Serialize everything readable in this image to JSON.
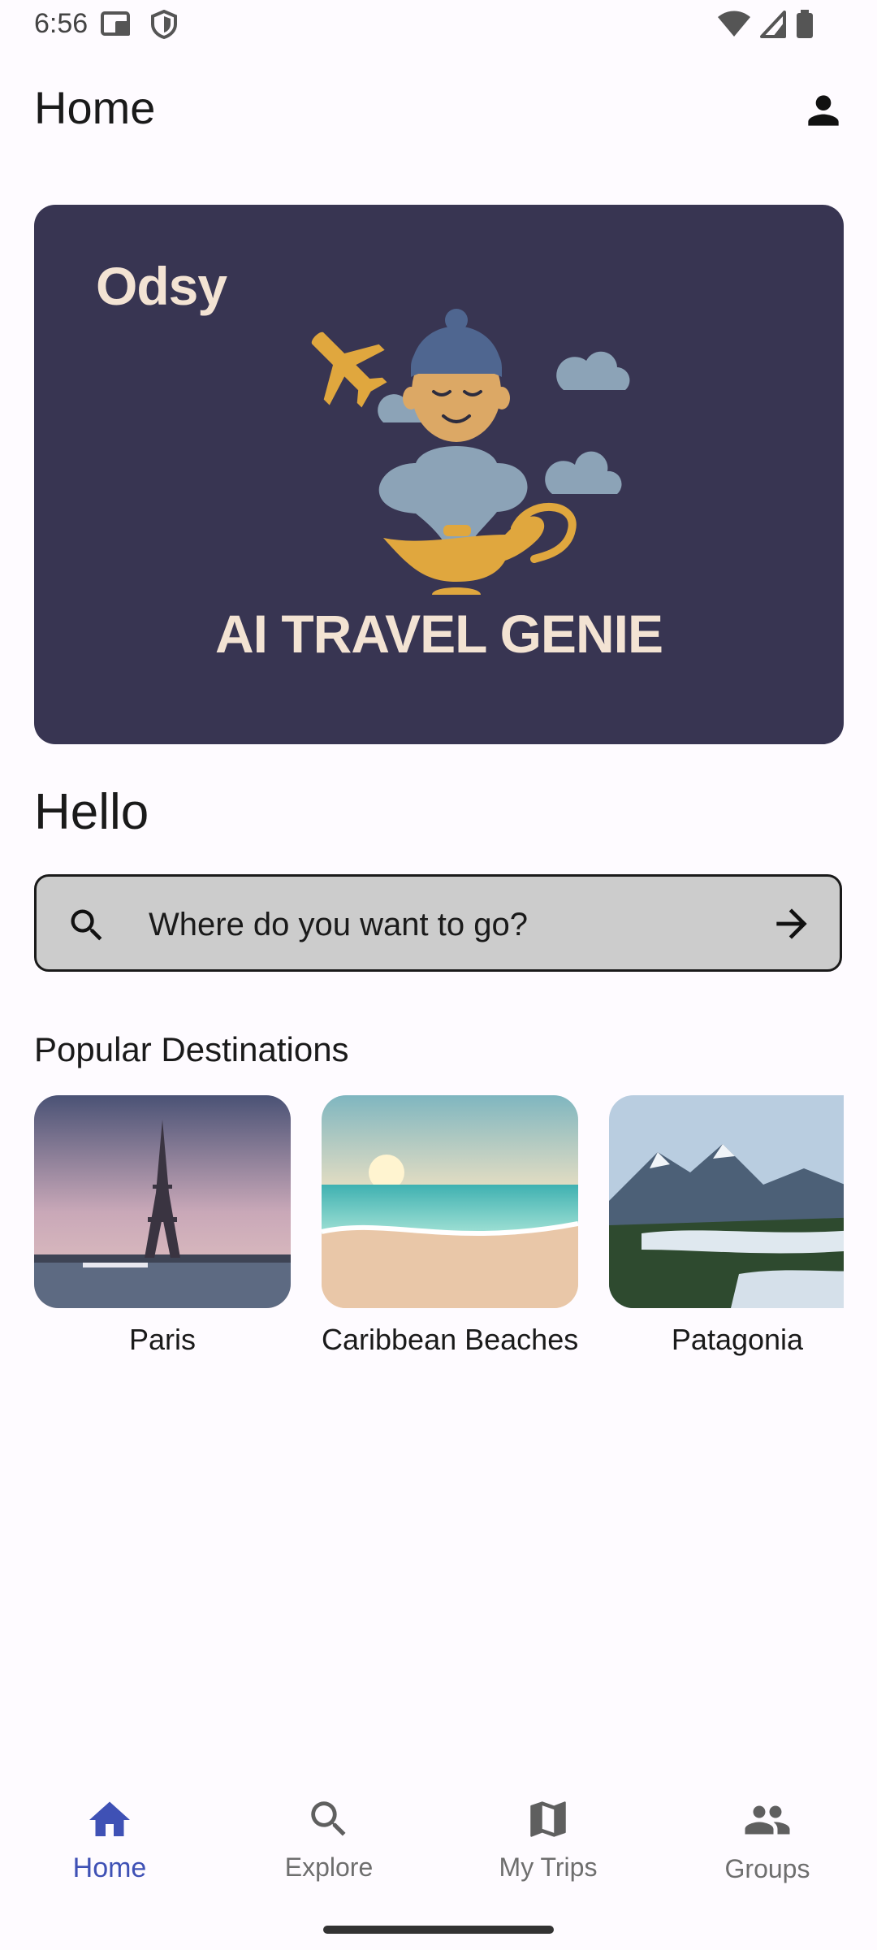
{
  "status_bar": {
    "time": "6:56",
    "left_icons": [
      "cast-icon",
      "shield-icon"
    ],
    "right_icons": [
      "wifi-icon",
      "signal-icon",
      "battery-icon"
    ]
  },
  "app_bar": {
    "title": "Home",
    "profile_icon": "person-icon"
  },
  "banner": {
    "brand": "Odsy",
    "tagline": "AI TRAVEL GENIE",
    "background": "#383552",
    "text_color": "#f3e3d3",
    "accent_gold": "#e0a73e",
    "accent_blue": "#4f6690",
    "cloud_color": "#8ca3b7"
  },
  "greeting": "Hello",
  "search": {
    "placeholder": "Where do you want to go?",
    "value": "",
    "search_icon": "search-icon",
    "submit_icon": "arrow-right-icon"
  },
  "popular": {
    "title": "Popular Destinations",
    "items": [
      {
        "label": "Paris",
        "image": "eiffel-tower-photo"
      },
      {
        "label": "Caribbean Beaches",
        "image": "beach-sunset-photo"
      },
      {
        "label": "Patagonia",
        "image": "mountain-lake-photo"
      }
    ]
  },
  "bottom_nav": {
    "active": "Home",
    "active_color": "#3f51b5",
    "items": [
      {
        "label": "Home",
        "icon": "home-icon"
      },
      {
        "label": "Explore",
        "icon": "search-icon"
      },
      {
        "label": "My Trips",
        "icon": "map-icon"
      },
      {
        "label": "Groups",
        "icon": "people-icon"
      }
    ]
  }
}
